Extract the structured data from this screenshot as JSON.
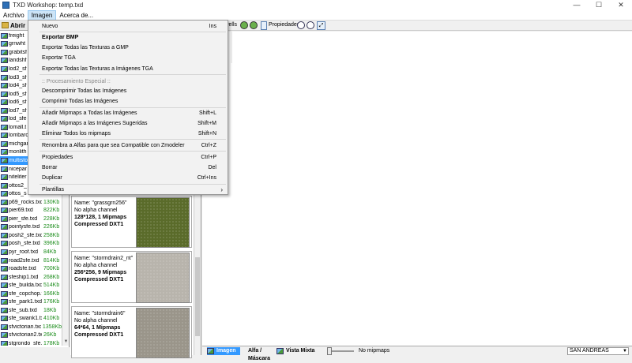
{
  "window": {
    "title": "TXD Workshop: temp.txd",
    "buttons": [
      "—",
      "☐",
      "✕"
    ]
  },
  "menubar": [
    "Archivo",
    "Imagen",
    "Acerca de..."
  ],
  "left_panel": {
    "header": "Abrir",
    "files": [
      {
        "name": "freight",
        "size": ""
      },
      {
        "name": "grnwht",
        "size": ""
      },
      {
        "name": "grabitsf",
        "size": ""
      },
      {
        "name": "landshf",
        "size": ""
      },
      {
        "name": "lod2_sf",
        "size": ""
      },
      {
        "name": "lod3_sf",
        "size": ""
      },
      {
        "name": "lod4_sf",
        "size": ""
      },
      {
        "name": "lod5_sf",
        "size": ""
      },
      {
        "name": "lod6_sf",
        "size": ""
      },
      {
        "name": "lod7_sf",
        "size": ""
      },
      {
        "name": "lod_sfe",
        "size": ""
      },
      {
        "name": "lomall.t",
        "size": ""
      },
      {
        "name": "lombarc",
        "size": ""
      },
      {
        "name": "michgar",
        "size": ""
      },
      {
        "name": "monlith",
        "size": ""
      },
      {
        "name": "multisto",
        "size": ""
      },
      {
        "name": "nicepar",
        "size": ""
      },
      {
        "name": "niteliter",
        "size": ""
      },
      {
        "name": "ottos2_",
        "size": ""
      },
      {
        "name": "ottos_s",
        "size": ""
      },
      {
        "name": "p69_rocks.txd",
        "size": "130Kb"
      },
      {
        "name": "pier69.txd",
        "size": "822Kb"
      },
      {
        "name": "pier_sfe.txd",
        "size": "228Kb"
      },
      {
        "name": "pointysfe.txd",
        "size": "226Kb"
      },
      {
        "name": "posh2_sfe.txd",
        "size": "258Kb"
      },
      {
        "name": "posh_sfe.txd",
        "size": "396Kb"
      },
      {
        "name": "pyr_roof.txd",
        "size": "84Kb"
      },
      {
        "name": "road2sfe.txd",
        "size": "814Kb"
      },
      {
        "name": "roadsfe.txd",
        "size": "700Kb"
      },
      {
        "name": "sfeship1.txd",
        "size": "268Kb"
      },
      {
        "name": "sfe_builda.txd",
        "size": "514Kb"
      },
      {
        "name": "sfe_copchop.tx",
        "size": "166Kb"
      },
      {
        "name": "sfe_park1.txd",
        "size": "176Kb"
      },
      {
        "name": "sfe_sub.txd",
        "size": "18Kb"
      },
      {
        "name": "sfe_swank1.tx",
        "size": "410Kb"
      },
      {
        "name": "sfvictorian.txd",
        "size": "1358Kb"
      },
      {
        "name": "sfvictorian2.tx",
        "size": "26Kb"
      },
      {
        "name": "stgrondo_sfe.tx",
        "size": "178Kb"
      }
    ],
    "selected_index": 15
  },
  "textures": [
    {
      "name": "Name: \"grassgrn256\"",
      "alpha": "No alpha channel",
      "dims": "128*128, 1 Mipmaps",
      "comp": "Compressed DXT1",
      "color": "#5a6b2a"
    },
    {
      "name": "Name: \"stormdrain2_nt\"",
      "alpha": "No alpha channel",
      "dims": "256*256, 9 Mipmaps",
      "comp": "Compressed DXT1",
      "color": "#b8b4ac"
    },
    {
      "name": "Name: \"stormdrain6\"",
      "alpha": "No alpha channel",
      "dims": "64*64, 1 Mipmaps",
      "comp": "Compressed DXT1",
      "color": "#9a958a"
    }
  ],
  "toolbar": {
    "prev_text": "vells",
    "props_label": "Propiedades"
  },
  "status": {
    "tab_image": "Imagen",
    "tab_alpha": "Alfa / Máscara",
    "tab_mixed": "Vista Mixta",
    "mipmaps": "No mipmaps",
    "game": "SAN ANDREAS"
  },
  "dropdown": {
    "items": [
      {
        "label": "Nuevo",
        "shortcut": "Ins",
        "style": ""
      },
      {
        "label": "Exportar BMP",
        "shortcut": "",
        "style": "bold"
      },
      {
        "label": "Exportar Todas las Texturas a GMP",
        "shortcut": "",
        "style": ""
      },
      {
        "label": "Exportar TGA",
        "shortcut": "",
        "style": ""
      },
      {
        "label": "Exportar Todas las Texturas a Imágenes TGA",
        "shortcut": "",
        "style": ""
      },
      {
        "label": ":: Procesamiento Especial ::",
        "shortcut": "",
        "style": "disabled"
      },
      {
        "label": "Descomprimir Todas las Imágenes",
        "shortcut": "",
        "style": ""
      },
      {
        "label": "Comprimir Todas las Imágenes",
        "shortcut": "",
        "style": ""
      },
      {
        "label": "Añadir Mipmaps a Todas las Imágenes",
        "shortcut": "Shift+L",
        "style": ""
      },
      {
        "label": "Añadir Mipmaps a las Imágenes Sugeridas",
        "shortcut": "Shift+M",
        "style": ""
      },
      {
        "label": "Eliminar Todos los mipmaps",
        "shortcut": "Shift+N",
        "style": ""
      },
      {
        "label": "Renombra a Alfas para que sea Compatible con Zmodeler",
        "shortcut": "Ctrl+Z",
        "style": ""
      },
      {
        "label": "Propiedades",
        "shortcut": "Ctrl+P",
        "style": ""
      },
      {
        "label": "Borrar",
        "shortcut": "Del",
        "style": ""
      },
      {
        "label": "Duplicar",
        "shortcut": "Ctrl+Ins",
        "style": ""
      },
      {
        "label": "Plantillas",
        "shortcut": "",
        "style": "",
        "submenu": "›"
      }
    ]
  }
}
